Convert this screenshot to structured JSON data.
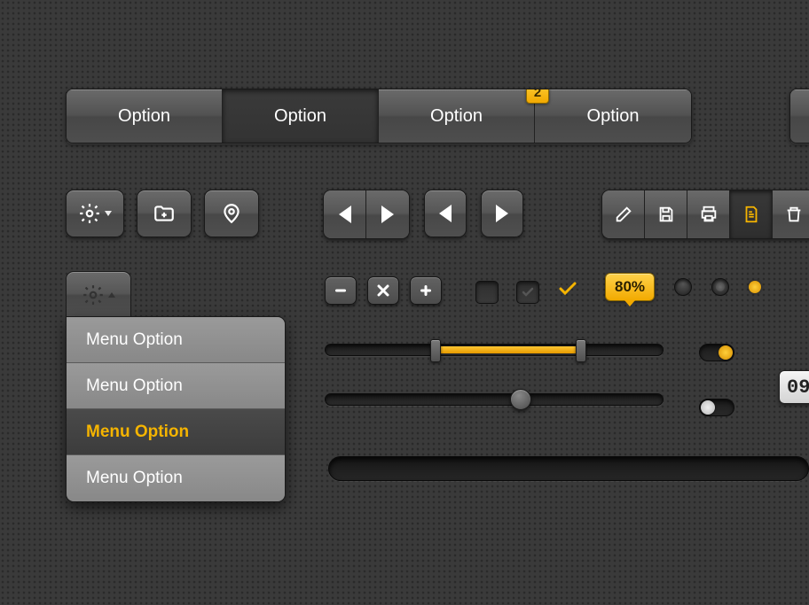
{
  "optbar": {
    "items": [
      "Option",
      "Option",
      "Option",
      "Option"
    ],
    "active": 1,
    "badge": {
      "index": 3,
      "value": "2"
    }
  },
  "menu": {
    "items": [
      "Menu Option",
      "Menu Option",
      "Menu Option",
      "Menu Option"
    ],
    "selected": 2
  },
  "percent": "80%",
  "counter": "09",
  "colors": {
    "accent": "#f5b400"
  }
}
